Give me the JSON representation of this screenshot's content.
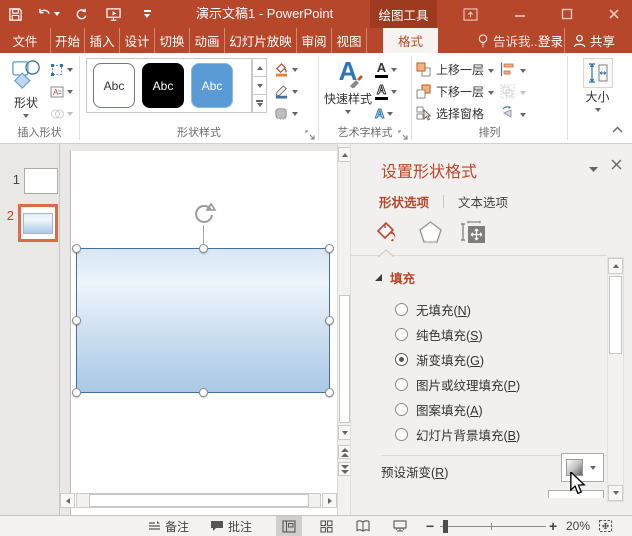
{
  "titlebar": {
    "title": "演示文稿1 - PowerPoint",
    "contextual_tool": "绘图工具"
  },
  "tabs": {
    "file": "文件",
    "home": "开始",
    "insert": "插入",
    "design": "设计",
    "transitions": "切换",
    "animations": "动画",
    "slideshow": "幻灯片放映",
    "review": "审阅",
    "view": "视图",
    "active_format": "格式",
    "tell_me": "告诉我...",
    "sign_in": "登录",
    "share": "共享"
  },
  "ribbon": {
    "insert_shapes": {
      "shapes_button": "形状",
      "label": "插入形状"
    },
    "shape_styles": {
      "label": "形状样式",
      "tiles": [
        {
          "label": "Abc"
        },
        {
          "label": "Abc"
        },
        {
          "label": "Abc"
        }
      ]
    },
    "wordart": {
      "quick_styles": "快速样式",
      "label": "艺术字样式",
      "icon_letter": "A"
    },
    "arrange": {
      "bring_forward": "上移一层",
      "send_backward": "下移一层",
      "selection_pane": "选择窗格",
      "label": "排列"
    },
    "size": {
      "label": "大小"
    }
  },
  "slides": [
    {
      "number": "1"
    },
    {
      "number": "2"
    }
  ],
  "pane": {
    "title": "设置形状格式",
    "tab_shape": "形状选项",
    "tab_text": "文本选项",
    "fill_section": "填充",
    "fill_options": [
      {
        "pre": "无填充(",
        "key": "N",
        "post": ")"
      },
      {
        "pre": "纯色填充(",
        "key": "S",
        "post": ")"
      },
      {
        "pre": "渐变填充(",
        "key": "G",
        "post": ")"
      },
      {
        "pre": "图片或纹理填充(",
        "key": "P",
        "post": ")"
      },
      {
        "pre": "图案填充(",
        "key": "A",
        "post": ")"
      },
      {
        "pre": "幻灯片背景填充(",
        "key": "B",
        "post": ")"
      }
    ],
    "preset_gradient": {
      "pre": "预设渐变(",
      "key": "R",
      "post": ")"
    }
  },
  "statusbar": {
    "notes": "备注",
    "comments": "批注",
    "zoom_out": "−",
    "zoom_in": "+",
    "zoom_level": "20%"
  },
  "colors": {
    "titlebar_red": "#B7472A",
    "contextual_dark": "#9E3A20",
    "accent_blue_tile": "#5B9BD5",
    "selected_slide_border": "#DD6B45",
    "pane_title_red": "#C0442B",
    "shape_border": "#41719C"
  }
}
